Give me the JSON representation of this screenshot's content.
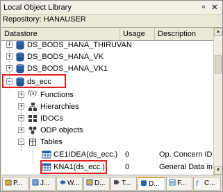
{
  "window": {
    "title": "Local Object Library",
    "pin_icon": "pin-icon",
    "close_icon": "close-icon"
  },
  "repository": {
    "label": "Repository: HANAUSER"
  },
  "columns": {
    "datastore": "Datastore",
    "usage": "Usage",
    "description": "Description"
  },
  "tree": {
    "ds1": "DS_BODS_HANA_THIRUVAN",
    "ds2": "DS_BODS_HANA_VK",
    "ds3": "DS_BODS_HANA_VK1",
    "ds4": "ds_ecc",
    "functions": "Functions",
    "functions_icon_text": "f(x)",
    "hierarchies": "Hierarchies",
    "idocs": "IDOCs",
    "odp": "ODP objects",
    "tables": "Tables",
    "table1": {
      "name": "CE1IDEA(ds_ecc.)",
      "usage": "0",
      "description": "Op. Concern ID"
    },
    "table2": {
      "name": "KNA1(ds_ecc.)",
      "usage": "0",
      "description": "General Data in"
    }
  },
  "tabs": [
    {
      "label": "P...",
      "icon": "project-icon"
    },
    {
      "label": "J...",
      "icon": "job-icon"
    },
    {
      "label": "W...",
      "icon": "workflow-icon"
    },
    {
      "label": "D...",
      "icon": "dataflow-icon"
    },
    {
      "label": "T...",
      "icon": "transform-icon"
    },
    {
      "label": "D...",
      "icon": "datastore-icon"
    },
    {
      "label": "F...",
      "icon": "format-icon"
    },
    {
      "label": "C...",
      "icon": "custom-function-icon"
    }
  ],
  "colors": {
    "highlight": "#e02020",
    "db_icon": "#2d5fa8"
  }
}
